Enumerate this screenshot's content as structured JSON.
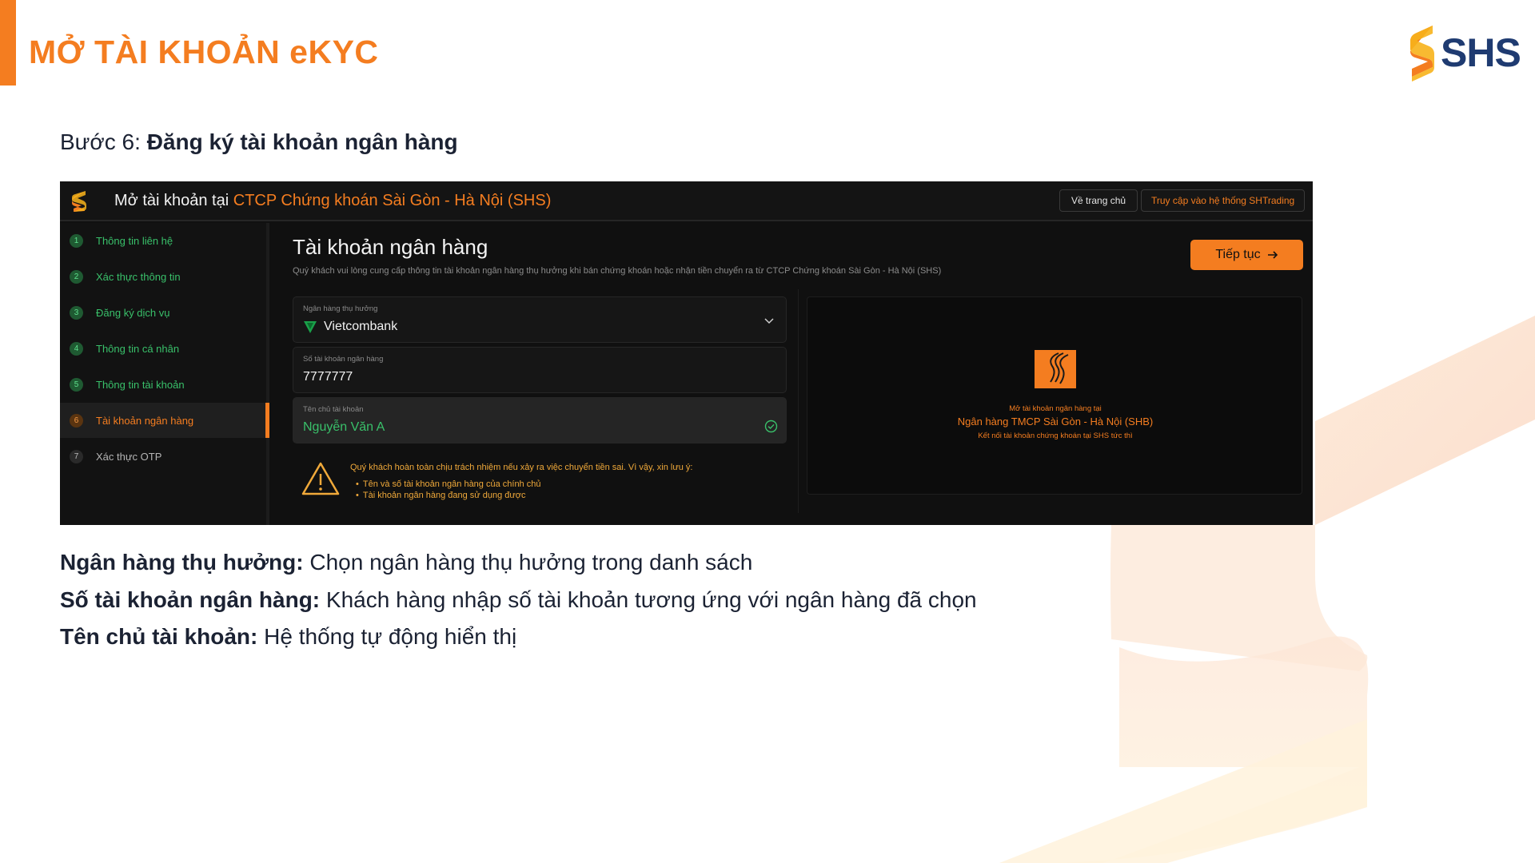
{
  "slide": {
    "title": "MỞ TÀI KHOẢN eKYC",
    "logo_text": "SHS",
    "step_prefix": "Bước 6:",
    "step_title": "Đăng ký tài khoản ngân hàng"
  },
  "app": {
    "heading_prefix": "Mở tài khoản tại",
    "heading_org": "CTCP Chứng khoán Sài Gòn - Hà Nội (SHS)",
    "btn_home": "Về trang chủ",
    "btn_trading": "Truy cập vào hệ thống SHTrading",
    "steps": [
      {
        "num": "1",
        "label": "Thông tin liên hệ"
      },
      {
        "num": "2",
        "label": "Xác thực thông tin"
      },
      {
        "num": "3",
        "label": "Đăng ký dịch vụ"
      },
      {
        "num": "4",
        "label": "Thông tin cá nhân"
      },
      {
        "num": "5",
        "label": "Thông tin tài khoản"
      },
      {
        "num": "6",
        "label": "Tài khoản ngân hàng"
      },
      {
        "num": "7",
        "label": "Xác thực OTP"
      }
    ],
    "main_title": "Tài khoản ngân hàng",
    "main_sub": "Quý khách vui lòng cung cấp thông tin tài khoản ngân hàng thụ hưởng khi bán chứng khoán hoặc nhận tiền chuyển ra từ CTCP Chứng khoán Sài Gòn - Hà Nội (SHS)",
    "btn_continue": "Tiếp tục",
    "bank_field": {
      "label": "Ngân hàng thụ hưởng",
      "value": "Vietcombank"
    },
    "account_field": {
      "label": "Số tài khoản ngân hàng",
      "value": "7777777"
    },
    "owner_field": {
      "label": "Tên chủ tài khoản",
      "value": "Nguyễn Văn A"
    },
    "warning_head": "Quý khách hoàn toàn chịu trách nhiệm nếu xảy ra việc chuyển tiền sai. Vì vậy, xin lưu ý:",
    "warning_items": [
      "Tên và số tài khoản ngân hàng của chính chủ",
      "Tài khoản ngân hàng đang sử dụng được"
    ],
    "card_line1": "Mở tài khoản ngân hàng tại",
    "card_line2": "Ngân hàng TMCP Sài Gòn - Hà Nội (SHB)",
    "card_line3": "Kết nối tài khoản chứng khoán tại SHS tức thì"
  },
  "descriptions": [
    {
      "term": "Ngân hàng thụ hưởng:",
      "text": " Chọn ngân hàng thụ hưởng trong danh sách"
    },
    {
      "term": "Số tài khoản ngân hàng:",
      "text": " Khách hàng nhập số tài khoản tương ứng với ngân hàng đã chọn"
    },
    {
      "term": "Tên chủ tài khoản:",
      "text": " Hệ thống tự động hiển thị"
    }
  ],
  "colors": {
    "brand_orange": "#f47d20",
    "brand_navy": "#1f3b71",
    "success_green": "#39c06a"
  }
}
